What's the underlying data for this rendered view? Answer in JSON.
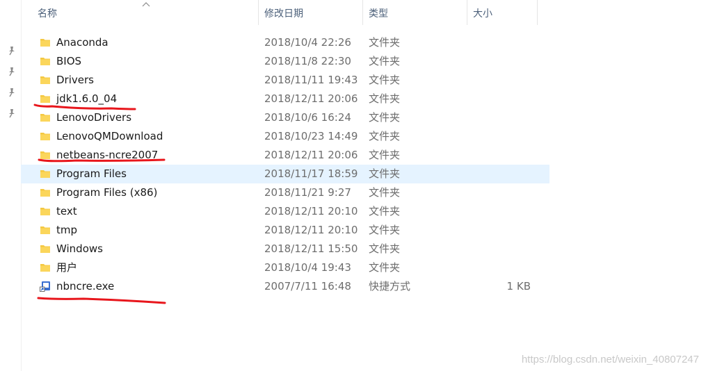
{
  "columns": {
    "name": "名称",
    "date": "修改日期",
    "type": "类型",
    "size": "大小"
  },
  "files": [
    {
      "name": "Anaconda",
      "date": "2018/10/4 22:26",
      "type": "文件夹",
      "size": "",
      "icon": "folder-icon",
      "selected": false
    },
    {
      "name": "BIOS",
      "date": "2018/11/8 22:30",
      "type": "文件夹",
      "size": "",
      "icon": "folder-icon",
      "selected": false
    },
    {
      "name": "Drivers",
      "date": "2018/11/11 19:43",
      "type": "文件夹",
      "size": "",
      "icon": "folder-icon",
      "selected": false
    },
    {
      "name": "jdk1.6.0_04",
      "date": "2018/12/11 20:06",
      "type": "文件夹",
      "size": "",
      "icon": "folder-icon",
      "selected": false
    },
    {
      "name": "LenovoDrivers",
      "date": "2018/10/6 16:24",
      "type": "文件夹",
      "size": "",
      "icon": "folder-icon",
      "selected": false
    },
    {
      "name": "LenovoQMDownload",
      "date": "2018/10/23 14:49",
      "type": "文件夹",
      "size": "",
      "icon": "folder-icon",
      "selected": false
    },
    {
      "name": "netbeans-ncre2007",
      "date": "2018/12/11 20:06",
      "type": "文件夹",
      "size": "",
      "icon": "folder-icon",
      "selected": false
    },
    {
      "name": "Program Files",
      "date": "2018/11/17 18:59",
      "type": "文件夹",
      "size": "",
      "icon": "folder-icon",
      "selected": true
    },
    {
      "name": "Program Files (x86)",
      "date": "2018/11/21 9:27",
      "type": "文件夹",
      "size": "",
      "icon": "folder-icon",
      "selected": false
    },
    {
      "name": "text",
      "date": "2018/12/11 20:10",
      "type": "文件夹",
      "size": "",
      "icon": "folder-icon",
      "selected": false
    },
    {
      "name": "tmp",
      "date": "2018/12/11 20:10",
      "type": "文件夹",
      "size": "",
      "icon": "folder-icon",
      "selected": false
    },
    {
      "name": "Windows",
      "date": "2018/12/11 15:50",
      "type": "文件夹",
      "size": "",
      "icon": "folder-icon",
      "selected": false
    },
    {
      "name": "用户",
      "date": "2018/10/4 19:43",
      "type": "文件夹",
      "size": "",
      "icon": "folder-icon",
      "selected": false
    },
    {
      "name": "nbncre.exe",
      "date": "2007/7/11 16:48",
      "type": "快捷方式",
      "size": "1 KB",
      "icon": "shortcut-exe-icon",
      "selected": false
    }
  ],
  "pinned_icons": [
    "pin-icon",
    "pin-icon",
    "pin-icon",
    "pin-icon"
  ],
  "watermark": "https://blog.csdn.net/weixin_40807247",
  "colors": {
    "header_text": "#4c607a",
    "selected_row": "#e5f3ff",
    "folder": "#f4c842",
    "annotation": "#e8161c"
  }
}
